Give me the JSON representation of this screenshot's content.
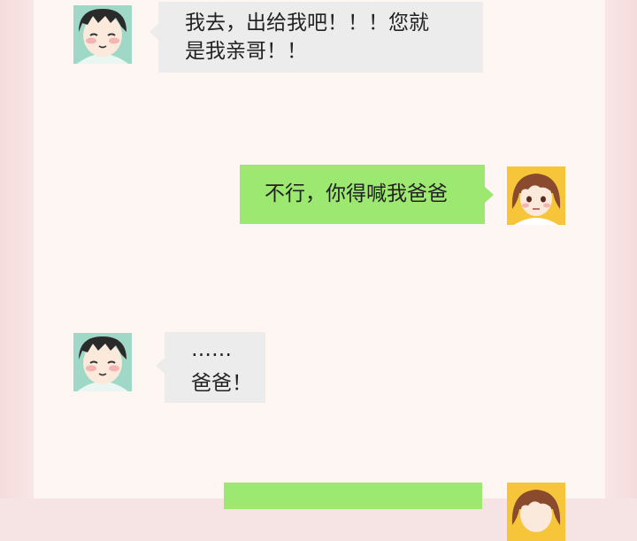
{
  "messages": [
    {
      "side": "left",
      "lines": [
        "我去，出给我吧！！！您就",
        "是我亲哥！！"
      ]
    },
    {
      "side": "right",
      "lines": [
        "不行，你得喊我爸爸"
      ]
    },
    {
      "side": "left",
      "lines": [
        "……",
        "爸爸！"
      ]
    },
    {
      "side": "right",
      "lines": [
        ""
      ]
    }
  ],
  "colors": {
    "page_bg": "#f6e4e4",
    "panel_bg": "#fdf6f2",
    "left_bubble": "#ececec",
    "right_bubble": "#9ce870",
    "boy_avatar_bg": "#9fd8c6",
    "girl_avatar_bg": "#f7c53a"
  },
  "icons": {
    "left_avatar": "boy-avatar-icon",
    "right_avatar": "girl-avatar-icon"
  }
}
